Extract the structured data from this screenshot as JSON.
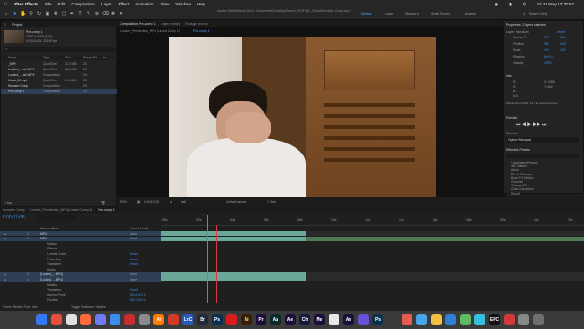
{
  "menubar": {
    "app": "After Effects",
    "items": [
      "File",
      "Edit",
      "Composition",
      "Layer",
      "Effect",
      "Animation",
      "View",
      "Window",
      "Help"
    ],
    "clock": "Fri 31 May  13:30:57"
  },
  "toolbar": {
    "title": "Adobe After Effects 2019 - /Users/mdl/Desktop/Users/_EDITING_Shoot/Monster Comp.aep *",
    "workspaces": [
      "Default",
      "Learn",
      "Standard",
      "Small Screen",
      "Libraries"
    ],
    "search_placeholder": "Search Help"
  },
  "project": {
    "tab": "Project",
    "selected_name": "Pre-comp 1",
    "selected_info": "1920 x 1080 (1.00)",
    "selected_duration": "0;00;18;05, 23.976 fps",
    "columns": [
      "Name",
      "Type",
      "Size",
      "Frame Ra",
      "In"
    ],
    "items": [
      {
        "name": "_MP4",
        "type": "QuickTime",
        "size": "13.7 MB",
        "fps": "24"
      },
      {
        "name": "Looked_...ate.MP4",
        "type": "QuickTime",
        "size": "38.4 MB",
        "fps": "24"
      },
      {
        "name": "Looked_...ate MP4",
        "type": "Composition",
        "size": "",
        "fps": "24"
      },
      {
        "name": "Mask_03.mp4",
        "type": "QuickTime",
        "size": "14.3 MB",
        "fps": "23"
      },
      {
        "name": "Monster Comp",
        "type": "Composition",
        "size": "",
        "fps": "23"
      },
      {
        "name": "Pre-comp 1",
        "type": "Composition",
        "size": "",
        "fps": "23"
      }
    ],
    "bpc": "8 bpc"
  },
  "viewer": {
    "tabs": [
      "Composition Pre-comp 1",
      "Layer (none)",
      "Footage (none)"
    ],
    "breadcrumbs": [
      "Looked_Pendientes_MP4 (Linked Comp 1)",
      "Pre-comp 1"
    ],
    "zoom": "50%",
    "timecode": "0;00;12;08",
    "resolution": "Half",
    "camera": "Active Camera",
    "view": "1 View"
  },
  "properties": {
    "title": "Properties: 2 layers selected",
    "section": "Layer Transform",
    "reset": "Reset",
    "rows": [
      {
        "label": "Anchor Po",
        "v1": "960",
        "v2": "540"
      },
      {
        "label": "Position",
        "v1": "960",
        "v2": "540"
      },
      {
        "label": "Scale",
        "v1": "100",
        "v2": "100"
      },
      {
        "label": "Rotation",
        "v1": "0x+0.0",
        "v2": ""
      },
      {
        "label": "Opacity",
        "v1": "100%",
        "v2": ""
      }
    ],
    "info_title": "Info",
    "info_lines": [
      "R:",
      "G:",
      "B:",
      "A: 0",
      "X: 1456",
      "Y: 482"
    ],
    "info_footer": "Playing from RAM: 24 / 12 cached frames",
    "preview_title": "Preview",
    "shortcut_label": "Shortcut",
    "shortcut_value": "Option+Numpad",
    "effects_title": "Effects & Presets",
    "effects": [
      "* Animation Presets",
      "3D Channel",
      "Audio",
      "Blur & Sharpen",
      "Boris FX Mocha",
      "Channel",
      "Cinema 4D",
      "Color Correction",
      "Distort"
    ]
  },
  "timeline": {
    "tabs": [
      "Monster Comp",
      "Looked_Pendientes_MP4 (Linked Comp 1)",
      "Pre-comp 1"
    ],
    "timecode": "0;00;12;08",
    "search_placeholder": "",
    "col_source": "Source Name",
    "col_parent": "Parent & Link",
    "ruler": [
      "00s",
      "02s",
      "04s",
      "06s",
      "08s",
      "10s",
      "12s",
      "14s",
      "16s",
      "18s",
      "20s",
      "22s",
      "24s"
    ],
    "layers": [
      {
        "num": "1",
        "name": "MP4",
        "parent": "None"
      },
      {
        "num": "2",
        "name": "MP4",
        "parent": "None"
      },
      {
        "num": "",
        "name": "Masks",
        "parent": ""
      },
      {
        "num": "",
        "name": "Effects",
        "parent": ""
      },
      {
        "num": "",
        "name": "Lumetri Color",
        "parent": "Reset"
      },
      {
        "num": "",
        "name": "Color Key",
        "parent": "Reset"
      },
      {
        "num": "",
        "name": "Transform",
        "parent": "Reset"
      },
      {
        "num": "",
        "name": "Audio",
        "parent": ""
      },
      {
        "num": "3",
        "name": "[Looked_...MP4]",
        "parent": "None"
      },
      {
        "num": "4",
        "name": "[Looked_...MP4]",
        "parent": "None"
      },
      {
        "num": "",
        "name": "Masks",
        "parent": ""
      },
      {
        "num": "",
        "name": "Transform",
        "parent": "Reset"
      },
      {
        "num": "",
        "name": "Anchor Point",
        "parent": "960.0,540.0"
      },
      {
        "num": "",
        "name": "Position",
        "parent": "960.0,540.0"
      }
    ],
    "footer": "Frame Render Time: 0ms",
    "footer_toggle": "Toggle Switches / Modes"
  },
  "dock": {
    "apps": [
      {
        "label": "",
        "color": "#3478f6"
      },
      {
        "label": "",
        "color": "#e94e3c"
      },
      {
        "label": "",
        "color": "#e0e0e0"
      },
      {
        "label": "",
        "color": "#ff6a3d"
      },
      {
        "label": "",
        "color": "#6f7bf7"
      },
      {
        "label": "",
        "color": "#3b8df0"
      },
      {
        "label": "",
        "color": "#c72d2d"
      },
      {
        "label": "",
        "color": "#8a8a8a"
      },
      {
        "label": "Ai",
        "color": "#ff7c00"
      },
      {
        "label": "",
        "color": "#d43a2a"
      },
      {
        "label": "LrC",
        "color": "#2a5bb8"
      },
      {
        "label": "Br",
        "color": "#1f2a3a"
      },
      {
        "label": "Ps",
        "color": "#0b2f4d"
      },
      {
        "label": "",
        "color": "#d81b1b"
      },
      {
        "label": "Ai",
        "color": "#3a1e00"
      },
      {
        "label": "Pr",
        "color": "#1a0f3a"
      },
      {
        "label": "Au",
        "color": "#0a2a2a"
      },
      {
        "label": "Ae",
        "color": "#1a0e3d"
      },
      {
        "label": "Ch",
        "color": "#141a3a"
      },
      {
        "label": "Me",
        "color": "#1a0e3d"
      },
      {
        "label": "",
        "color": "#e8e8e8"
      },
      {
        "label": "Ae",
        "color": "#1a0e3d"
      },
      {
        "label": "",
        "color": "#6a4fd8"
      },
      {
        "label": "Ps",
        "color": "#0b2f4d"
      },
      {
        "label": "",
        "color": "#3a3a3a"
      },
      {
        "label": "",
        "color": "#e65c4f"
      },
      {
        "label": "",
        "color": "#4aa5e8"
      },
      {
        "label": "",
        "color": "#f0c040"
      },
      {
        "label": "",
        "color": "#2f7fd8"
      },
      {
        "label": "",
        "color": "#5dbb63"
      },
      {
        "label": "",
        "color": "#35c0e0"
      },
      {
        "label": "EPC",
        "color": "#111111"
      },
      {
        "label": "",
        "color": "#d23a3a"
      },
      {
        "label": "",
        "color": "#888888"
      },
      {
        "label": "",
        "color": "#6e6e6e"
      }
    ]
  },
  "colors": {
    "accent": "#3f8ee8",
    "playhead": "#3f8ee8",
    "work_end": "#d83a3a",
    "track_teal": "#6aa89a",
    "track_green": "#4f7a55"
  }
}
